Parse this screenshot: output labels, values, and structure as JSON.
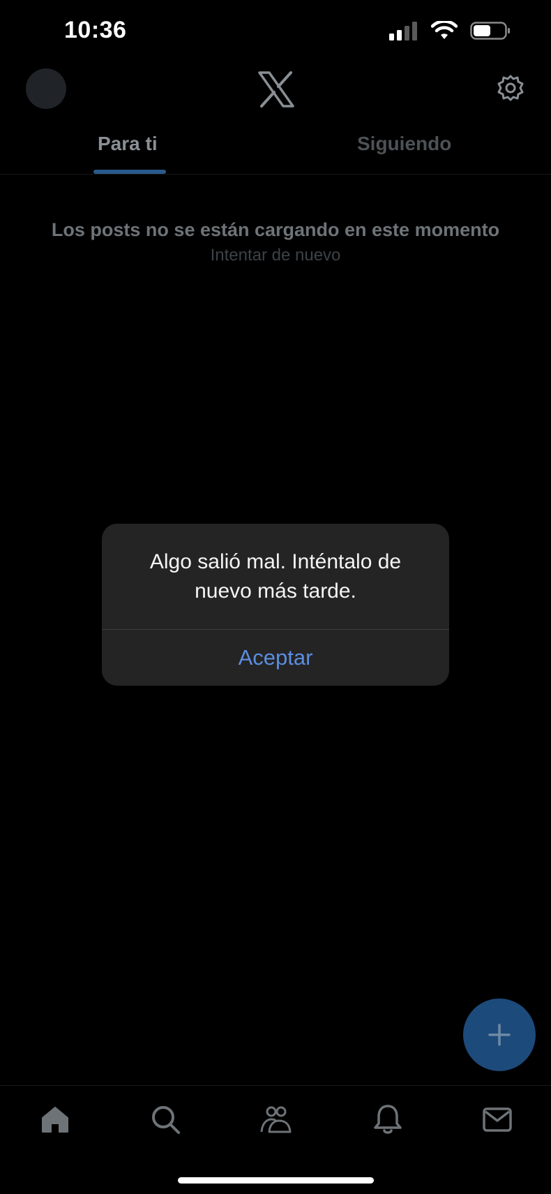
{
  "status_bar": {
    "time": "10:36",
    "icons": [
      "signal-icon",
      "wifi-icon",
      "battery-icon"
    ]
  },
  "header": {
    "logo": "x-logo-icon",
    "settings_icon": "gear-icon"
  },
  "tabs": [
    {
      "label": "Para ti",
      "active": true
    },
    {
      "label": "Siguiendo",
      "active": false
    }
  ],
  "feed": {
    "error_title": "Los posts no se están cargando en este momento",
    "retry_label": "Intentar de nuevo"
  },
  "alert": {
    "message": "Algo salió mal. Inténtalo de nuevo más tarde.",
    "button_label": "Aceptar"
  },
  "fab": {
    "icon": "plus-icon"
  },
  "bottom_nav": [
    {
      "icon": "home-icon"
    },
    {
      "icon": "search-icon"
    },
    {
      "icon": "communities-icon"
    },
    {
      "icon": "bell-icon"
    },
    {
      "icon": "mail-icon"
    }
  ],
  "colors": {
    "background": "#000000",
    "accent": "#1d9bf0",
    "alert_button": "#5b8ee0",
    "alert_background": "#242424"
  }
}
